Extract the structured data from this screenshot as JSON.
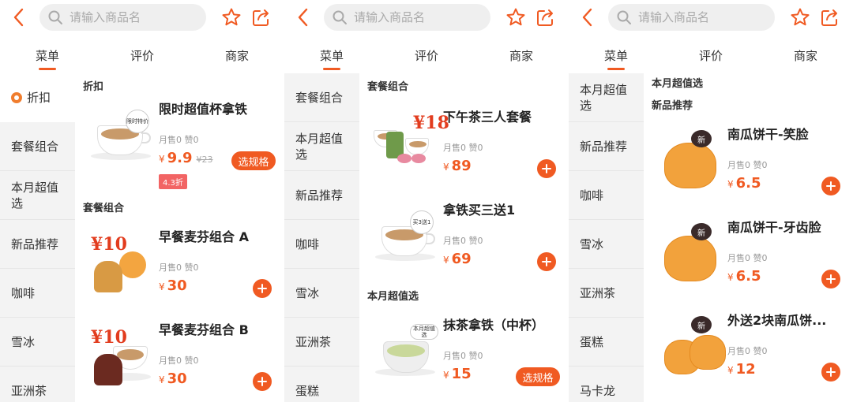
{
  "header": {
    "search_placeholder": "请输入商品名",
    "tabs": [
      "菜单",
      "评价",
      "商家"
    ]
  },
  "colors": {
    "accent": "#f05a22",
    "sidebar_bg": "#f3f3f3"
  },
  "icons": [
    "chevron-left-icon",
    "search-icon",
    "star-icon",
    "share-icon",
    "plus-icon"
  ],
  "panels": [
    {
      "sidebar": [
        "折扣",
        "套餐组合",
        "本月超值选",
        "新品推荐",
        "咖啡",
        "雪冰",
        "亚洲茶"
      ],
      "active_sidebar": "折扣",
      "sections": [
        {
          "title": "折扣",
          "items": [
            {
              "name": "限时超值杯拿铁",
              "sales": "月售0 赞0",
              "currency": "¥",
              "price": "9.9",
              "orig": "¥23",
              "discount": "4.3折",
              "action": "选规格",
              "thumb_tag": "限时特价"
            }
          ]
        },
        {
          "title": "套餐组合",
          "items": [
            {
              "name": "早餐麦芬组合 A",
              "sales": "月售0 赞0",
              "currency": "¥",
              "price": "30",
              "thumb_tag": "¥10"
            },
            {
              "name": "早餐麦芬组合 B",
              "sales": "月售0 赞0",
              "currency": "¥",
              "price": "30",
              "thumb_tag": "¥10"
            }
          ]
        }
      ]
    },
    {
      "sidebar": [
        "套餐组合",
        "本月超值选",
        "新品推荐",
        "咖啡",
        "雪冰",
        "亚洲茶",
        "蛋糕"
      ],
      "sections": [
        {
          "title": "套餐组合",
          "items": [
            {
              "name": "下午茶三人套餐",
              "sales": "月售0 赞0",
              "currency": "¥",
              "price": "89",
              "thumb_tag": "¥18"
            },
            {
              "name": "拿铁买三送1",
              "sales": "月售0 赞0",
              "currency": "¥",
              "price": "69",
              "thumb_tag": "买3送1"
            }
          ]
        },
        {
          "title": "本月超值选",
          "items": [
            {
              "name": "抹茶拿铁（中杯）",
              "sales": "月售0 赞0",
              "currency": "¥",
              "price": "15",
              "action": "选规格",
              "thumb_tag": "本月超值选"
            }
          ]
        }
      ]
    },
    {
      "sidebar": [
        "本月超值选",
        "新品推荐",
        "咖啡",
        "雪冰",
        "亚洲茶",
        "蛋糕",
        "马卡龙"
      ],
      "sections": [
        {
          "title": "本月超值选",
          "items": []
        },
        {
          "title": "新品推荐",
          "items": [
            {
              "name": "南瓜饼干-笑脸",
              "sales": "月售0 赞0",
              "currency": "¥",
              "price": "6.5",
              "thumb_tag": "新"
            },
            {
              "name": "南瓜饼干-牙齿脸",
              "sales": "月售0 赞0",
              "currency": "¥",
              "price": "6.5",
              "thumb_tag": "新"
            },
            {
              "name": "外送2块南瓜饼...",
              "sales": "月售0 赞0",
              "currency": "¥",
              "price": "12",
              "thumb_tag": "新"
            }
          ]
        }
      ]
    }
  ]
}
